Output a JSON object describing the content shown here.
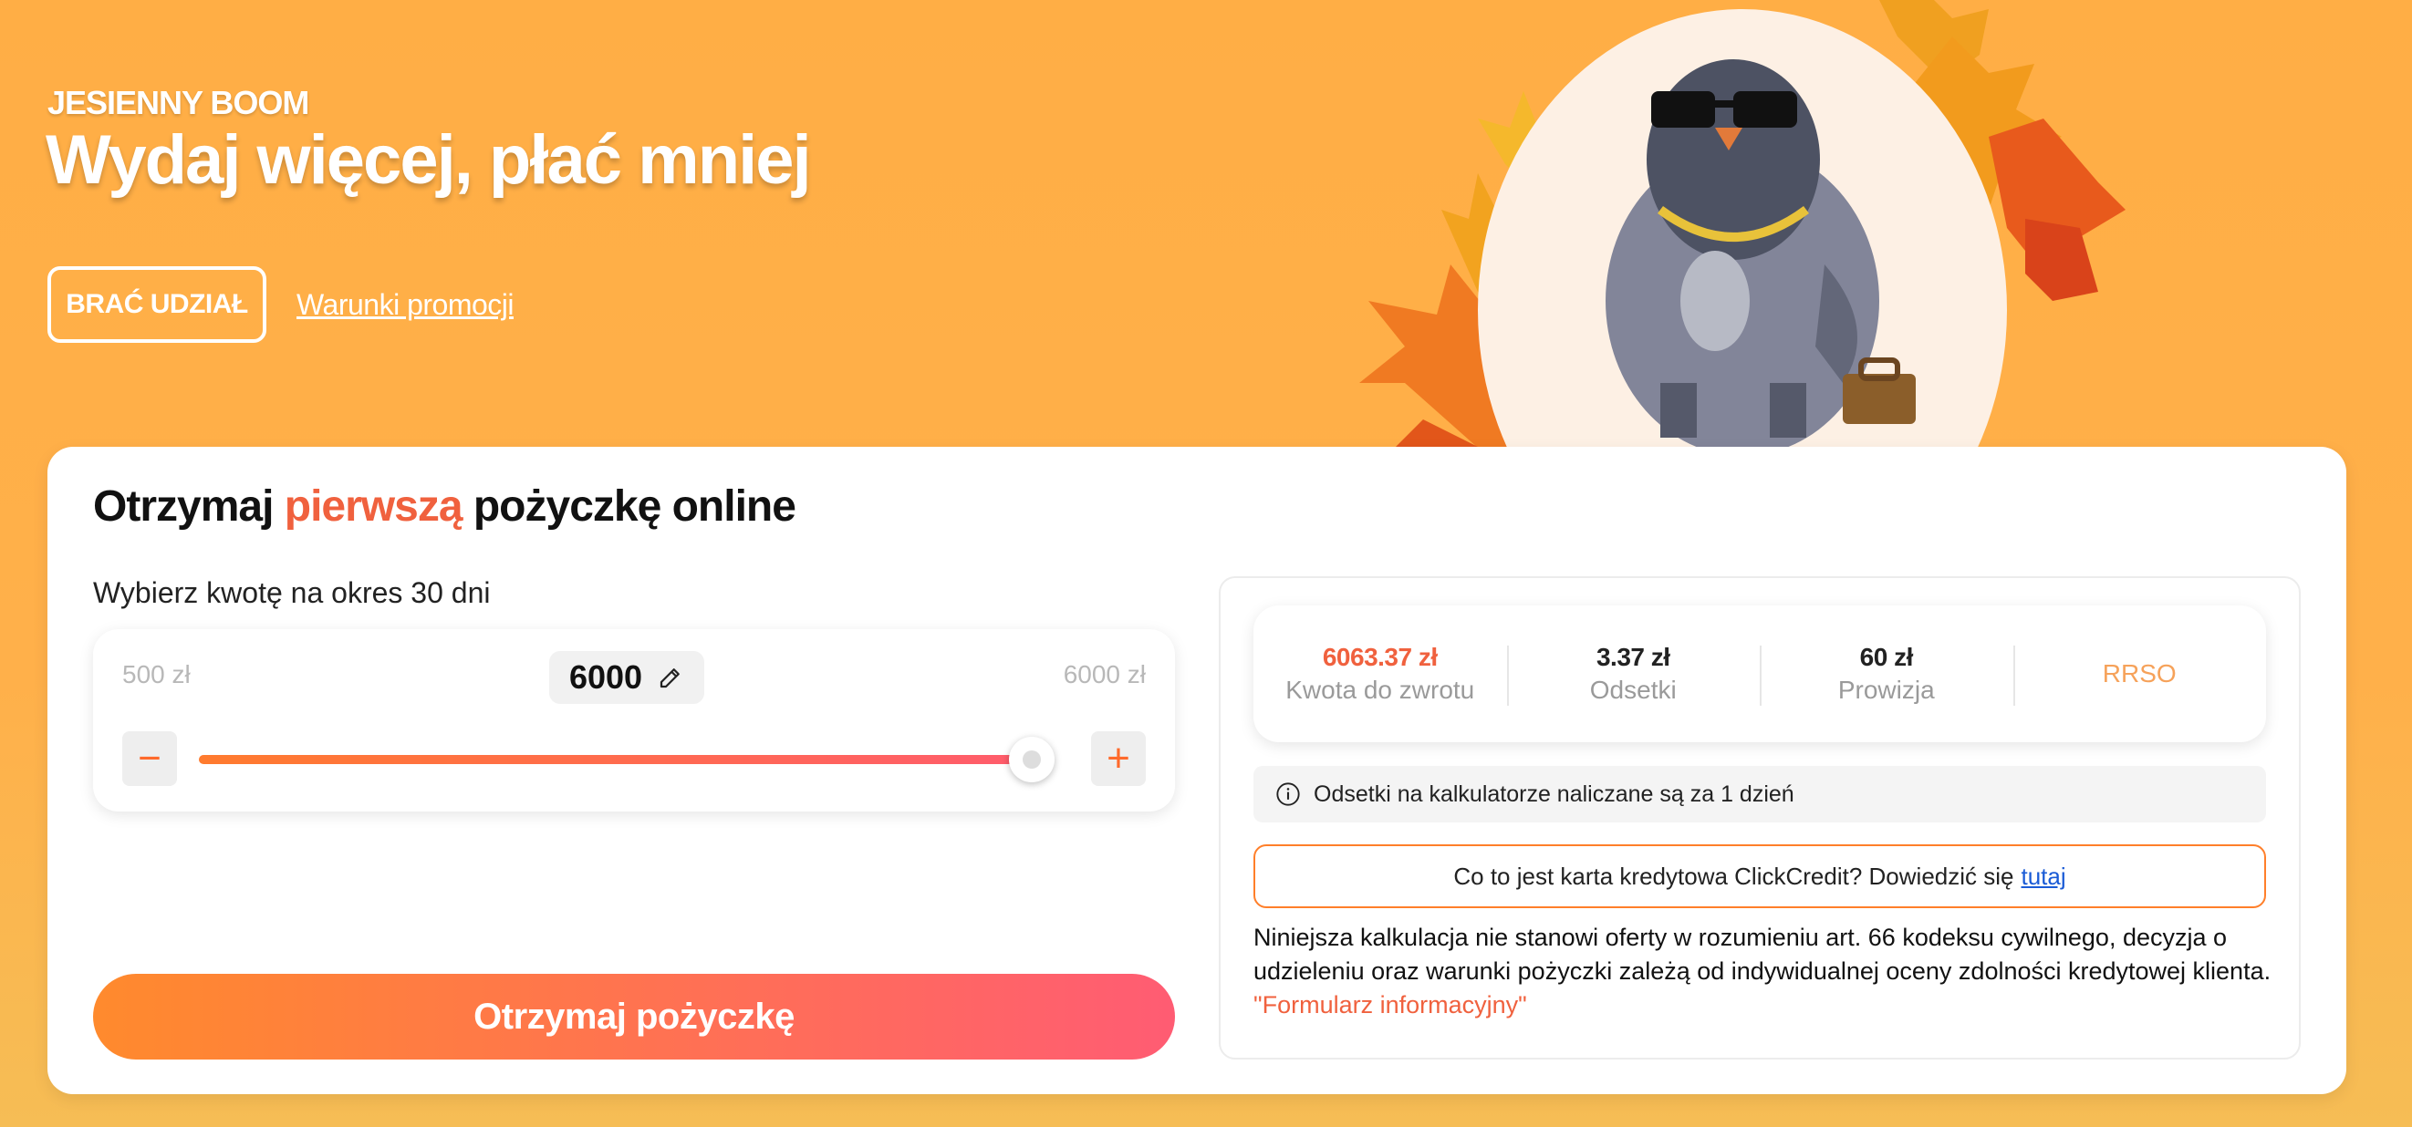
{
  "promo": {
    "tag": "JESIENNY BOOM",
    "title": "Wydaj więcej, płać mniej",
    "join_label": "BRAĆ UDZIAŁ",
    "terms_label": "Warunki promocji"
  },
  "calculator": {
    "title_before": "Otrzymaj ",
    "title_accent": "pierwszą",
    "title_after": " pożyczkę online",
    "period_label": "Wybierz kwotę na okres 30 dni",
    "min_label": "500 zł",
    "max_label": "6000 zł",
    "amount": "6000",
    "slider_value_fraction": 1.0,
    "minus_label": "−",
    "plus_label": "+",
    "submit_label": "Otrzymaj pożyczkę"
  },
  "summary": {
    "stats": [
      {
        "value": "6063.37 zł",
        "caption": "Kwota do zwrotu"
      },
      {
        "value": "3.37 zł",
        "caption": "Odsetki"
      },
      {
        "value": "60 zł",
        "caption": "Prowizja"
      },
      {
        "value": "RRSO"
      }
    ],
    "info_text": "Odsetki na kalkulatorze naliczane są za 1 dzień",
    "card_text": "Co to jest karta kredytowa ClickCredit? Dowiedzić się",
    "card_link": "tutaj",
    "disclaimer": "Niniejsza kalkulacja nie stanowi oferty w rozumieniu art. 66 kodeksu cywilnego, decyzja o udzieleniu oraz warunki pożyczki zależą od indywidualnej oceny zdolności kredytowej klienta.",
    "form_link": "\"Formularz informacyjny\""
  },
  "colors": {
    "accent": "#f0613e",
    "orange": "#ff7f2a",
    "background": "#ffae45"
  }
}
